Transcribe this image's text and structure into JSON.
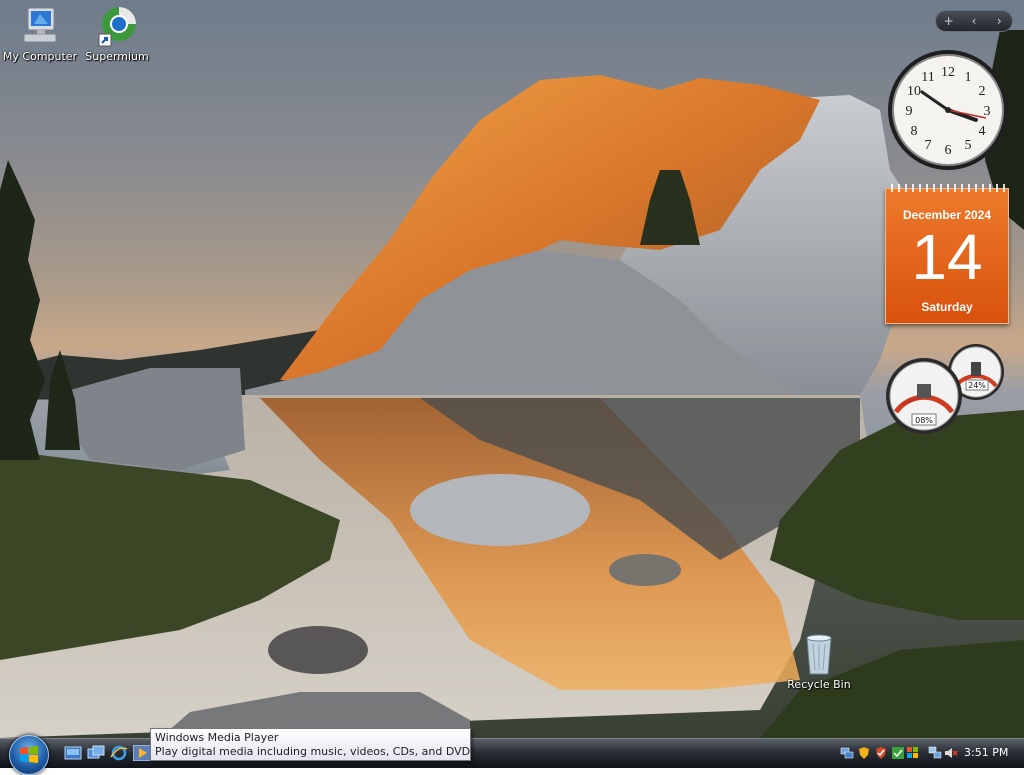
{
  "desktop_icons": {
    "my_computer": "My Computer",
    "supermium": "Supermium",
    "recycle_bin": "Recycle Bin"
  },
  "sidebar_controls": {
    "add": "+",
    "prev": "‹",
    "next": "›"
  },
  "clock_gadget": {
    "numbers": [
      "12",
      "1",
      "2",
      "3",
      "4",
      "5",
      "6",
      "7",
      "8",
      "9",
      "10",
      "11"
    ],
    "hour_hand_time": "3:51"
  },
  "calendar_gadget": {
    "month_year": "December 2024",
    "day": "14",
    "weekday": "Saturday"
  },
  "cpu_gadget": {
    "cpu_percent": "08%",
    "memory_percent": "24%"
  },
  "tooltip": {
    "title": "Windows Media Player",
    "description": "Play digital media including music, videos, CDs, and DVDs."
  },
  "taskbar": {
    "time": "3:51 PM"
  },
  "colors": {
    "calendar_accent": "#e2651b",
    "taskbar": "#1a1f26"
  }
}
